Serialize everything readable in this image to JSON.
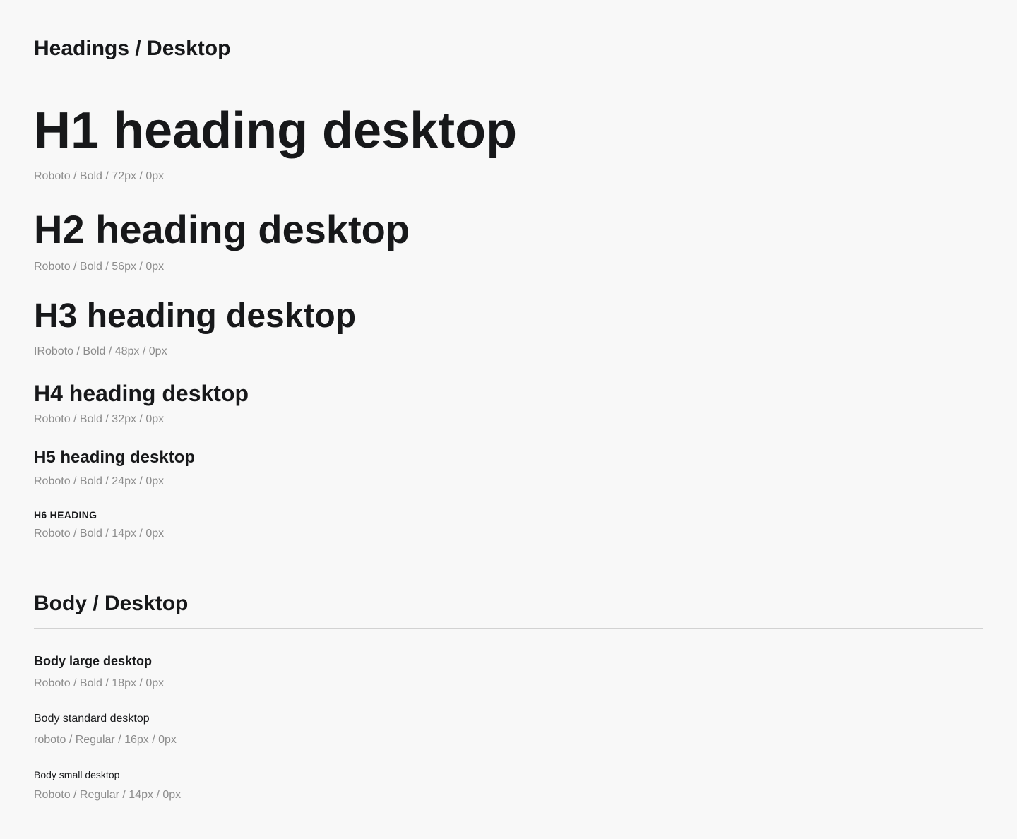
{
  "headings_section": {
    "title": "Headings / Desktop",
    "items": [
      {
        "sample": "H1 heading desktop",
        "spec": "Roboto / Bold / 72px / 0px"
      },
      {
        "sample": "H2 heading desktop",
        "spec": "Roboto / Bold / 56px / 0px"
      },
      {
        "sample": "H3 heading desktop",
        "spec": "IRoboto / Bold / 48px / 0px"
      },
      {
        "sample": "H4 heading desktop",
        "spec": "Roboto / Bold / 32px / 0px"
      },
      {
        "sample": "H5 heading desktop",
        "spec": "Roboto / Bold / 24px / 0px"
      },
      {
        "sample": "H6 HEADING",
        "spec": "Roboto / Bold / 14px / 0px"
      }
    ]
  },
  "body_section": {
    "title": "Body / Desktop",
    "items": [
      {
        "sample": "Body large desktop",
        "spec": "Roboto / Bold / 18px / 0px"
      },
      {
        "sample": "Body standard desktop",
        "spec": "roboto / Regular / 16px / 0px"
      },
      {
        "sample": "Body small desktop",
        "spec": "Roboto / Regular / 14px / 0px"
      }
    ]
  }
}
